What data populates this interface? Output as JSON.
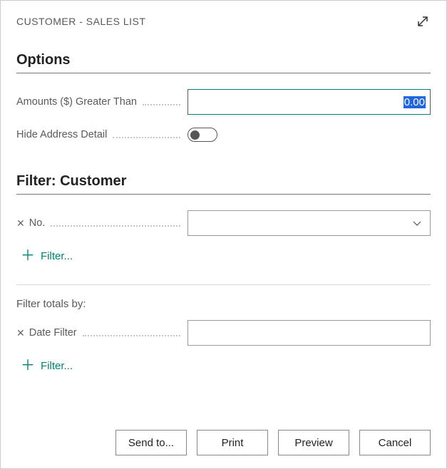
{
  "dialog": {
    "title": "CUSTOMER - SALES LIST"
  },
  "sections": {
    "options": {
      "title": "Options",
      "amounts_label": "Amounts ($) Greater Than",
      "amounts_value": "0.00",
      "hide_address_label": "Hide Address Detail",
      "hide_address_value": false
    },
    "filter_customer": {
      "title": "Filter: Customer",
      "no_label": "No.",
      "no_value": "",
      "add_filter_label": "Filter..."
    },
    "filter_totals": {
      "subheading": "Filter totals by:",
      "date_filter_label": "Date Filter",
      "date_filter_value": "",
      "add_filter_label": "Filter..."
    }
  },
  "footer": {
    "send_to": "Send to...",
    "print": "Print",
    "preview": "Preview",
    "cancel": "Cancel"
  }
}
